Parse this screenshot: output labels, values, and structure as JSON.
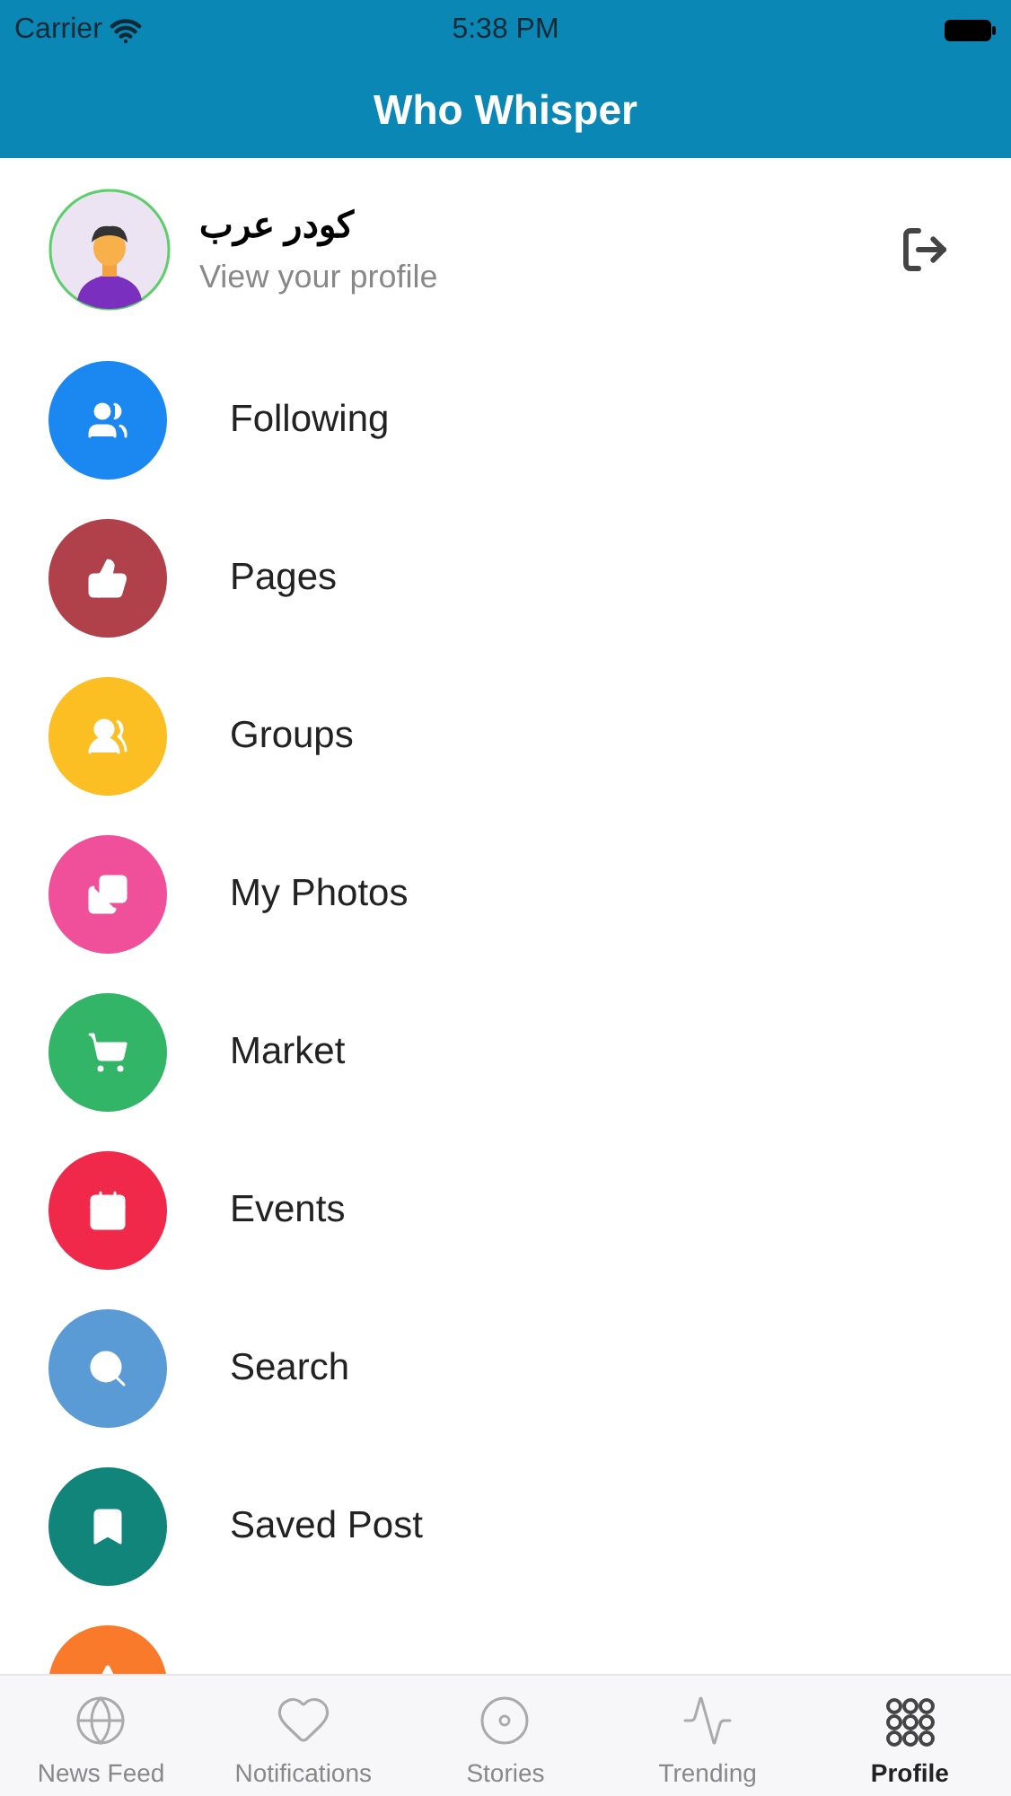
{
  "status_bar": {
    "carrier": "Carrier",
    "time": "5:38 PM"
  },
  "header": {
    "title": "Who Whisper"
  },
  "profile": {
    "name": "كودر عرب",
    "subtitle": "View your profile"
  },
  "menu": [
    {
      "label": "Following",
      "color": "#1a88f0"
    },
    {
      "label": "Pages",
      "color": "#b0404a"
    },
    {
      "label": "Groups",
      "color": "#fbbf24"
    },
    {
      "label": "My Photos",
      "color": "#f0509a"
    },
    {
      "label": "Market",
      "color": "#32b566"
    },
    {
      "label": "Events",
      "color": "#f0284a"
    },
    {
      "label": "Search",
      "color": "#5b9bd5"
    },
    {
      "label": "Saved Post",
      "color": "#12857a"
    },
    {
      "color": "#f97a2a"
    }
  ],
  "tabs": [
    {
      "label": "News Feed",
      "selected": false
    },
    {
      "label": "Notifications",
      "selected": false
    },
    {
      "label": "Stories",
      "selected": false
    },
    {
      "label": "Trending",
      "selected": false
    },
    {
      "label": "Profile",
      "selected": true
    }
  ]
}
